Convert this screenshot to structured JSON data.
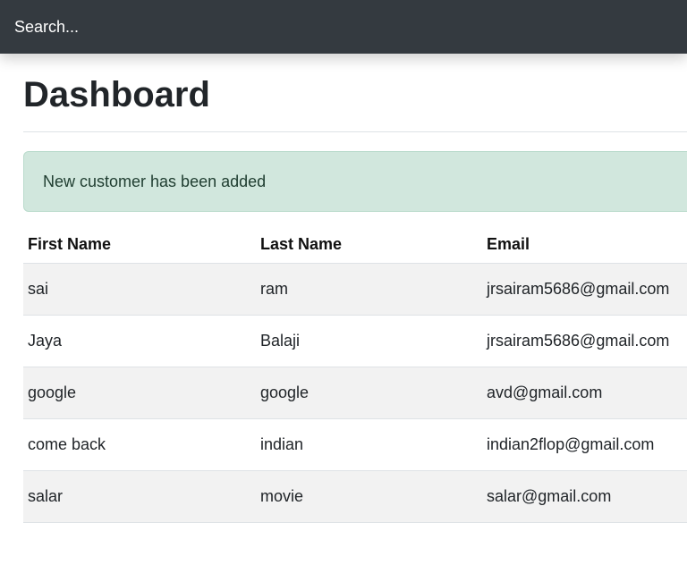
{
  "search": {
    "placeholder": "Search..."
  },
  "page": {
    "title": "Dashboard"
  },
  "alert": {
    "message": "New customer has been added"
  },
  "table": {
    "headers": [
      "First Name",
      "Last Name",
      "Email"
    ],
    "rows": [
      [
        "sai",
        "ram",
        "jrsairam5686@gmail.com"
      ],
      [
        "Jaya",
        "Balaji",
        "jrsairam5686@gmail.com"
      ],
      [
        "google",
        "google",
        "avd@gmail.com"
      ],
      [
        "come back",
        "indian",
        "indian2flop@gmail.com"
      ],
      [
        "salar",
        "movie",
        "salar@gmail.com"
      ]
    ]
  }
}
